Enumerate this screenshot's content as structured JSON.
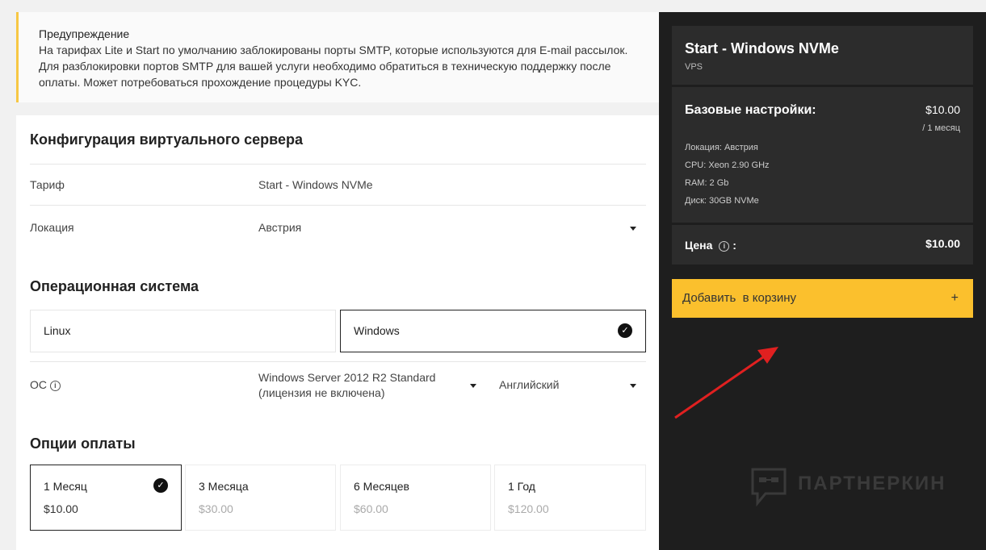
{
  "warning": {
    "title": "Предупреждение",
    "text": "На тарифах Lite и Start по умолчанию заблокированы порты SMTP, которые используются для E-mail рассылок. Для разблокировки портов SMTP для вашей услуги необходимо обратиться в техническую поддержку после оплаты. Может потребоваться прохождение процедуры KYC."
  },
  "config": {
    "title": "Конфигурация виртуального сервера",
    "tariff_label": "Тариф",
    "tariff_value": "Start - Windows NVMe",
    "location_label": "Локация",
    "location_value": "Австрия"
  },
  "os_section": {
    "title": "Операционная система",
    "options": [
      "Linux",
      "Windows"
    ],
    "selected": "Windows",
    "os_label": "ОС",
    "os_value_line1": "Windows Server 2012 R2 Standard",
    "os_value_line2": "(лицензия не включена)",
    "lang_value": "Английский"
  },
  "payment": {
    "title": "Опции оплаты",
    "options": [
      {
        "label": "1 Месяц",
        "price": "$10.00",
        "selected": true
      },
      {
        "label": "3 Месяца",
        "price": "$30.00",
        "selected": false
      },
      {
        "label": "6 Месяцев",
        "price": "$60.00",
        "selected": false
      },
      {
        "label": "1 Год",
        "price": "$120.00",
        "selected": false
      }
    ]
  },
  "summary": {
    "product_title": "Start - Windows NVMe",
    "product_type": "VPS",
    "base_title": "Базовые настройки:",
    "base_price": "$10.00",
    "base_period": "/ 1 месяц",
    "specs": [
      "Локация: Австрия",
      "CPU: Xeon 2.90 GHz",
      "RAM: 2 Gb",
      "Диск: 30GB NVMe"
    ],
    "price_label": "Цена",
    "price_colon": ":",
    "price_value": "$10.00",
    "add_to_cart": "Добавить  в корзину",
    "plus": "+"
  },
  "watermark": {
    "text": "ПАРТНЕРКИН"
  },
  "colors": {
    "accent": "#fbc02d",
    "dark_panel": "#1e1e1e",
    "card_dark": "#2c2c2c",
    "arrow": "#e02020"
  },
  "icons": {
    "check": "check-circle-icon",
    "info": "info-icon",
    "caret": "caret-down-icon"
  }
}
